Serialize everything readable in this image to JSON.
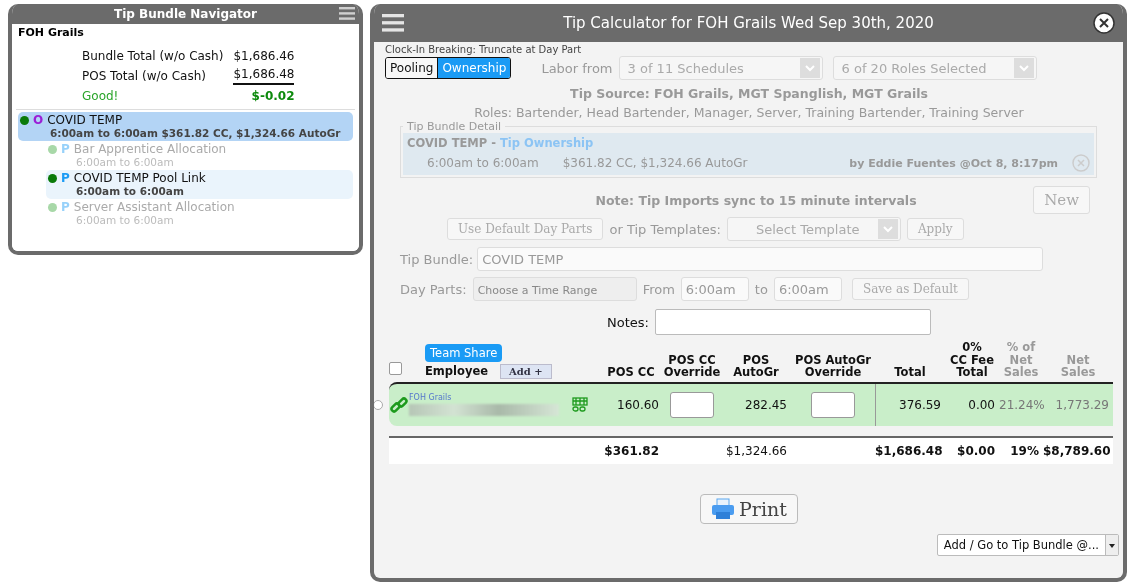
{
  "navigator": {
    "title": "Tip Bundle Navigator",
    "location": "FOH Grails",
    "totals": [
      {
        "label": "Bundle Total (w/o Cash)",
        "value": "$1,686.46"
      },
      {
        "label": "POS Total (w/o Cash)",
        "value": "$1,686.48"
      }
    ],
    "difference": {
      "label": "Good!",
      "value": "$-0.02"
    },
    "bundles": [
      {
        "kind": "ownership",
        "letter": "O",
        "name": "COVID TEMP",
        "detail": "6:00am to 6:00am $361.82 CC, $1,324.66 AutoGr",
        "active": true,
        "selected": true,
        "children": [
          {
            "kind": "pool",
            "letter": "P",
            "name": "Bar Apprentice Allocation",
            "detail": "6:00am to 6:00am",
            "active": false,
            "selected": false
          },
          {
            "kind": "pool",
            "letter": "P",
            "name": "COVID TEMP Pool Link",
            "detail": "6:00am to 6:00am",
            "active": true,
            "selected": false
          },
          {
            "kind": "pool",
            "letter": "P",
            "name": "Server Assistant Allocation",
            "detail": "6:00am to 6:00am",
            "active": false,
            "selected": false
          }
        ]
      }
    ]
  },
  "calculator": {
    "title": "Tip Calculator for FOH Grails Wed Sep 30th, 2020",
    "clock_in": "Clock-In Breaking: Truncate at Day Part",
    "modes": [
      {
        "label": "Pooling",
        "selected": false
      },
      {
        "label": "Ownership",
        "selected": true
      }
    ],
    "labor_label": "Labor from",
    "schedules": "3 of 11 Schedules",
    "roles_select": "6 of 20 Roles Selected",
    "tip_source": "Tip Source: FOH Grails, MGT Spanglish, MGT Grails",
    "roles": "Roles: Bartender, Head Bartender, Manager, Server, Training Bartender, Training Server",
    "detail": {
      "legend": "Tip Bundle Detail",
      "name": "COVID TEMP",
      "separator": " - ",
      "type": "Tip Ownership",
      "time": "6:00am to 6:00am",
      "amounts": "$361.82 CC, $1,324.66 AutoGr",
      "by": "by Eddie Fuentes @Oct 8, 8:17pm"
    },
    "note": "Note: Tip Imports sync to 15 minute intervals",
    "new_button": "New",
    "default_button": "Use Default Day Parts",
    "templates_label": "or Tip Templates:",
    "template_select": "Select Template",
    "apply_button": "Apply",
    "bundle_label": "Tip Bundle:",
    "bundle_value": "COVID TEMP",
    "day_parts_label": "Day Parts:",
    "day_parts_placeholder": "Choose a Time Range",
    "from_label": "From",
    "from_value": "6:00am",
    "to_label": "to",
    "to_value": "6:00am",
    "save_default": "Save as Default",
    "notes_label": "Notes:",
    "select_all_checked": false,
    "team_share": "Team Share",
    "add_button": "Add +",
    "columns": [
      {
        "label": "Employee",
        "muted": false
      },
      {
        "label": "POS CC",
        "muted": false
      },
      {
        "label": "POS CC\nOverride",
        "muted": false
      },
      {
        "label": "POS\nAutoGr",
        "muted": false
      },
      {
        "label": "POS AutoGr\nOverride",
        "muted": false
      },
      {
        "label": "Total",
        "muted": false
      },
      {
        "label": "0%\nCC Fee\nTotal",
        "muted": false
      },
      {
        "label": "% of\nNet\nSales",
        "muted": true
      },
      {
        "label": "Net\nSales",
        "muted": true
      }
    ],
    "rows": [
      {
        "group": "FOH Grails",
        "selected": false,
        "pos_cc": "160.60",
        "pos_autogr": "282.45",
        "total": "376.59",
        "cc_fee": "0.00",
        "pct": "21.24%",
        "net_sales": "1,773.29"
      }
    ],
    "totals": {
      "pos_cc": "$361.82",
      "pos_autogr": "$1,324.66",
      "total": "$1,686.48",
      "cc_fee": "$0.00",
      "pct": "19%",
      "net_sales": "$8,789.60"
    },
    "print": "Print",
    "goto": "Add / Go to Tip Bundle @..."
  }
}
